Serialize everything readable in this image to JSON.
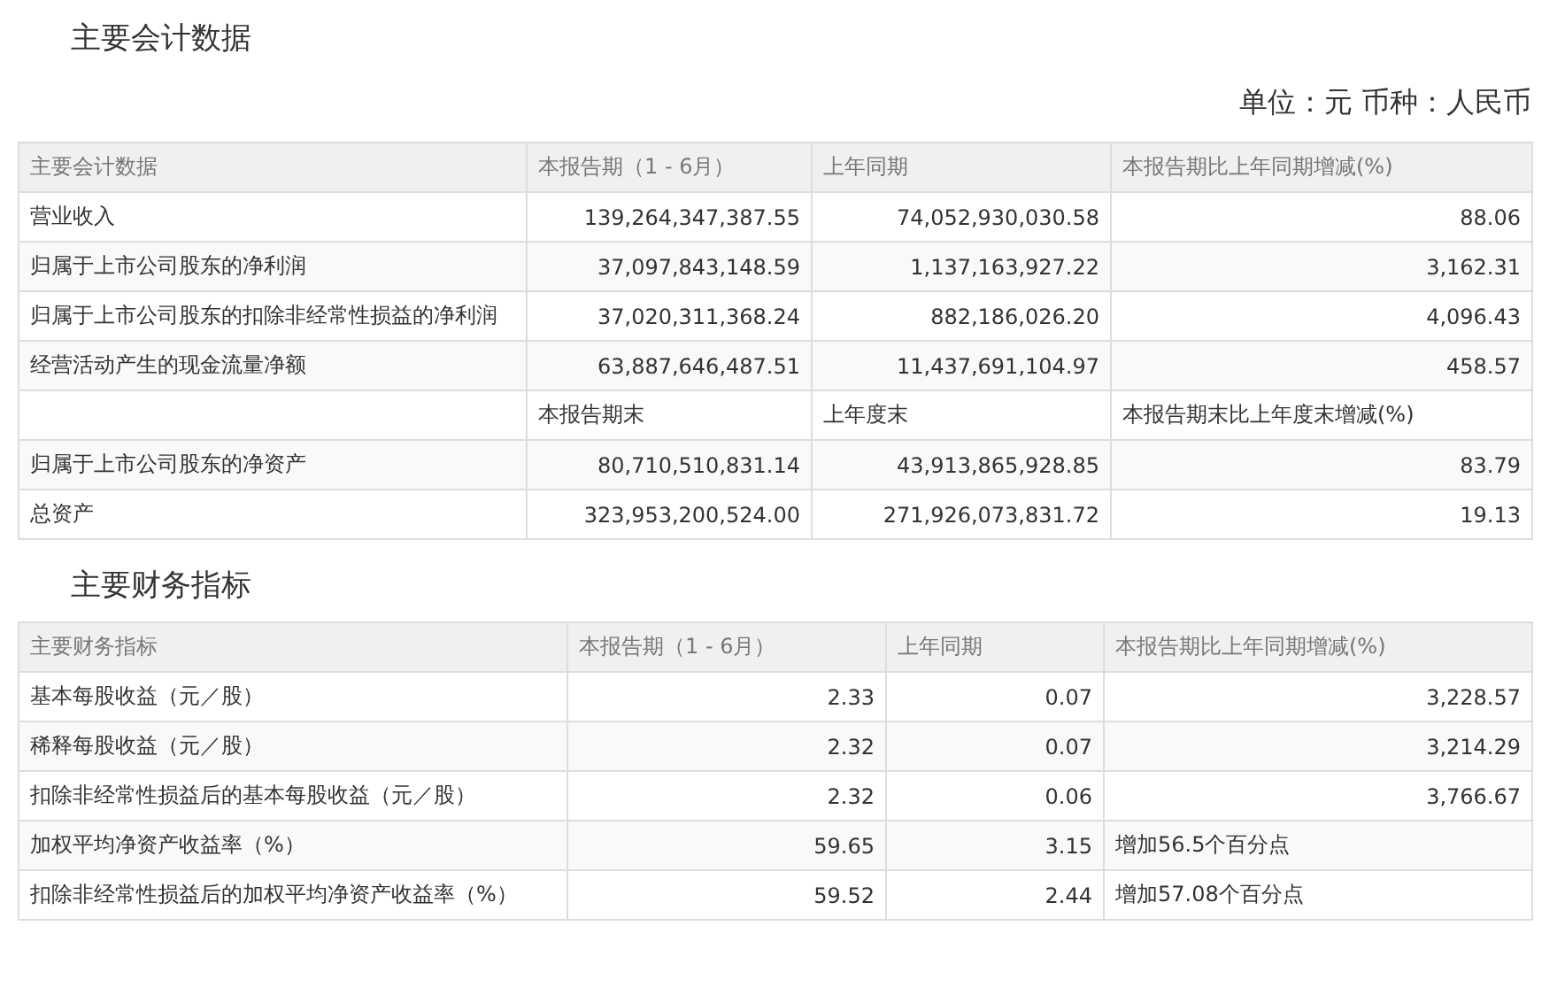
{
  "sections": [
    {
      "title": "主要会计数据",
      "unit": "单位：元 币种：人民币",
      "columns": [
        "主要会计数据",
        "本报告期（1 - 6月）",
        "上年同期",
        "本报告期比上年同期增减(%)"
      ],
      "rows": [
        {
          "kind": "data",
          "cells": [
            "营业收入",
            "139,264,347,387.55",
            "74,052,930,030.58",
            "88.06"
          ]
        },
        {
          "kind": "data",
          "cells": [
            "归属于上市公司股东的净利润",
            "37,097,843,148.59",
            "1,137,163,927.22",
            "3,162.31"
          ]
        },
        {
          "kind": "data",
          "cells": [
            "归属于上市公司股东的扣除非经常性损益的净利润",
            "37,020,311,368.24",
            "882,186,026.20",
            "4,096.43"
          ]
        },
        {
          "kind": "data",
          "cells": [
            "经营活动产生的现金流量净额",
            "63,887,646,487.51",
            "11,437,691,104.97",
            "458.57"
          ]
        },
        {
          "kind": "subheader",
          "cells": [
            "",
            "本报告期末",
            "上年度末",
            "本报告期末比上年度末增减(%)"
          ]
        },
        {
          "kind": "data",
          "cells": [
            "归属于上市公司股东的净资产",
            "80,710,510,831.14",
            "43,913,865,928.85",
            "83.79"
          ]
        },
        {
          "kind": "data",
          "cells": [
            "总资产",
            "323,953,200,524.00",
            "271,926,073,831.72",
            "19.13"
          ]
        }
      ]
    },
    {
      "title": "主要财务指标",
      "columns": [
        "主要财务指标",
        "本报告期（1 - 6月）",
        "上年同期",
        "本报告期比上年同期增减(%)"
      ],
      "rows": [
        {
          "kind": "data",
          "cells": [
            "基本每股收益（元／股）",
            "2.33",
            "0.07",
            "3,228.57"
          ]
        },
        {
          "kind": "data",
          "cells": [
            "稀释每股收益（元／股）",
            "2.32",
            "0.07",
            "3,214.29"
          ]
        },
        {
          "kind": "data",
          "cells": [
            "扣除非经常性损益后的基本每股收益（元／股）",
            "2.32",
            "0.06",
            "3,766.67"
          ]
        },
        {
          "kind": "note",
          "cells": [
            "加权平均净资产收益率（%）",
            "59.65",
            "3.15",
            "增加56.5个百分点"
          ]
        },
        {
          "kind": "note",
          "cells": [
            "扣除非经常性损益后的加权平均净资产收益率（%）",
            "59.52",
            "2.44",
            "增加57.08个百分点"
          ]
        }
      ]
    }
  ]
}
